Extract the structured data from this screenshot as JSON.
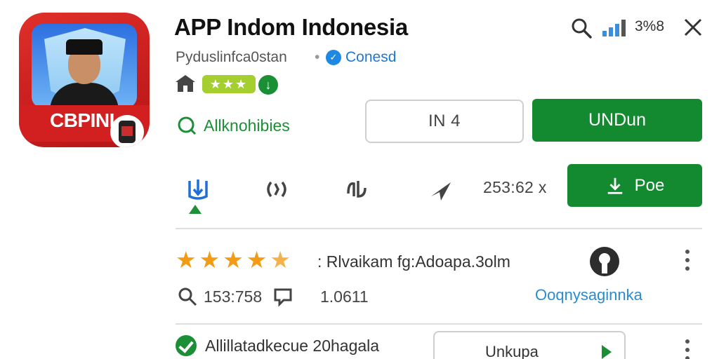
{
  "app": {
    "icon_text": "CBPINI",
    "title": "APP Indom Indonesia",
    "developer": "Pydusl​infca0stan",
    "developer_separator": "•",
    "developer_link": "Conesd",
    "rating_stars": "★★★"
  },
  "status": {
    "signal_text": "3%8"
  },
  "wishlist": {
    "label": "Allknohibies"
  },
  "buttons": {
    "outline_label": "IN 4",
    "install_label": "UNDun",
    "poe_label": "Poe",
    "update_label": "Unkupa"
  },
  "actions": {
    "size_text": "253:62 x"
  },
  "review": {
    "stars_filled": 5,
    "text": ": Rlvaikam fg:Adoapa.3olm",
    "stat_one": "153:758",
    "stat_two": "1.0611",
    "link": "Ooqnysaginnka"
  },
  "bottom": {
    "text": "Allillatadkecue 20hagala"
  },
  "colors": {
    "accent_green": "#138a2f",
    "link_blue": "#1e78d2",
    "star_orange": "#f29b14",
    "brand_red": "#d21f1f"
  }
}
